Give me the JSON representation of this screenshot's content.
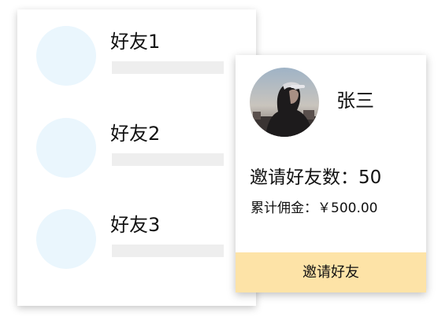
{
  "friends": [
    {
      "name": "好友1"
    },
    {
      "name": "好友2"
    },
    {
      "name": "好友3"
    }
  ],
  "profile": {
    "name": "张三",
    "invite_count_text": "邀请好友数：50",
    "commission_text": "累计佣金：￥500.00",
    "invite_button_label": "邀请好友"
  },
  "colors": {
    "avatar_placeholder": "#eaf6fd",
    "name_bar": "#eeeeee",
    "button_bg": "#fde3a7"
  }
}
